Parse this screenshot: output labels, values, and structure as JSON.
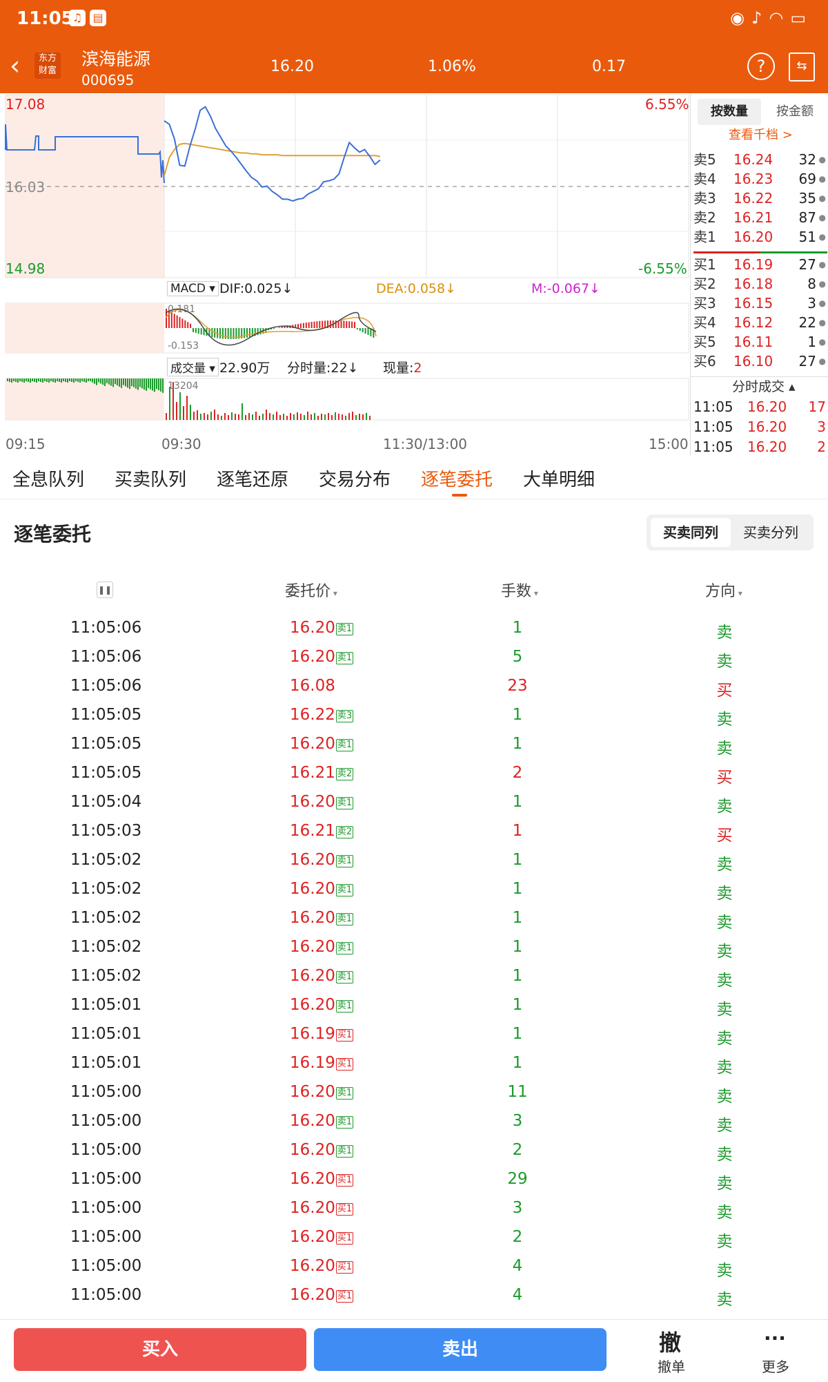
{
  "status_bar": {
    "time": "11:05"
  },
  "header": {
    "logo_text": "东方财富",
    "stock_name": "滨海能源",
    "stock_code": "000695",
    "price": "16.20",
    "change_pct": "1.06%",
    "change": "0.17"
  },
  "chart": {
    "price_high": "17.08",
    "price_low": "14.98",
    "price_mid": "16.03",
    "pct_high": "6.55%",
    "pct_low": "-6.55%",
    "macd_label": "MACD",
    "dif": "DIF:0.025",
    "dea": "DEA:0.058",
    "m": "M:-0.067",
    "macd_top": "0.181",
    "macd_bot": "-0.153",
    "vol_label": "成交量",
    "vol_total": "22.90万",
    "vol_min": "分时量:22",
    "vol_now_label": "现量:",
    "vol_now": "2",
    "vol_max": "13204",
    "time_start": "09:15",
    "time_open": "09:30",
    "time_mid": "11:30/13:00",
    "time_end": "15:00",
    "price_line": [
      16.78,
      16.74,
      16.57,
      16.27,
      16.26,
      16.49,
      16.68,
      16.9,
      16.94,
      16.83,
      16.69,
      16.59,
      16.49,
      16.43,
      16.36,
      16.28,
      16.2,
      16.13,
      16.09,
      16.02,
      16.03,
      15.97,
      15.93,
      15.88,
      15.88,
      15.86,
      15.88,
      15.89,
      15.94,
      15.97,
      16.0,
      16.08,
      16.09,
      16.11,
      16.17,
      16.36,
      16.53,
      16.47,
      16.42,
      16.45,
      16.37,
      16.28,
      16.33
    ],
    "avg_line": [
      16.15,
      16.36,
      16.45,
      16.51,
      16.52,
      16.51,
      16.5,
      16.49,
      16.48,
      16.47,
      16.46,
      16.45,
      16.44,
      16.43,
      16.42,
      16.41,
      16.41,
      16.4,
      16.4,
      16.39,
      16.39,
      16.39,
      16.39,
      16.38,
      16.38,
      16.38,
      16.38,
      16.38,
      16.38,
      16.38,
      16.38,
      16.38,
      16.38,
      16.38,
      16.38,
      16.38,
      16.38,
      16.38,
      16.38,
      16.38,
      16.38,
      16.38,
      16.37
    ]
  },
  "order_book": {
    "tab_qty": "按数量",
    "tab_amt": "按金额",
    "view_levels": "查看千档 >",
    "asks": [
      {
        "label": "卖5",
        "price": "16.24",
        "vol": "32"
      },
      {
        "label": "卖4",
        "price": "16.23",
        "vol": "69"
      },
      {
        "label": "卖3",
        "price": "16.22",
        "vol": "35"
      },
      {
        "label": "卖2",
        "price": "16.21",
        "vol": "87"
      },
      {
        "label": "卖1",
        "price": "16.20",
        "vol": "51"
      }
    ],
    "bids": [
      {
        "label": "买1",
        "price": "16.19",
        "vol": "27"
      },
      {
        "label": "买2",
        "price": "16.18",
        "vol": "8"
      },
      {
        "label": "买3",
        "price": "16.15",
        "vol": "3"
      },
      {
        "label": "买4",
        "price": "16.12",
        "vol": "22"
      },
      {
        "label": "买5",
        "price": "16.11",
        "vol": "1"
      },
      {
        "label": "买6",
        "price": "16.10",
        "vol": "27"
      }
    ],
    "trades_title": "分时成交",
    "trades": [
      {
        "time": "11:05",
        "price": "16.20",
        "vol": "17"
      },
      {
        "time": "11:05",
        "price": "16.20",
        "vol": "3"
      },
      {
        "time": "11:05",
        "price": "16.20",
        "vol": "2"
      }
    ]
  },
  "tabs": [
    "全息队列",
    "买卖队列",
    "逐笔还原",
    "交易分布",
    "逐笔委托",
    "大单明细"
  ],
  "section": {
    "title": "逐笔委托",
    "seg_same": "买卖同列",
    "seg_split": "买卖分列"
  },
  "table": {
    "col_price": "委托价",
    "col_qty": "手数",
    "col_dir": "方向",
    "rows": [
      {
        "time": "11:05:06",
        "price": "16.20",
        "badge": "卖1",
        "badge_color": "green",
        "qty": "1",
        "qty_color": "green",
        "dir": "卖",
        "dir_color": "green"
      },
      {
        "time": "11:05:06",
        "price": "16.20",
        "badge": "卖1",
        "badge_color": "green",
        "qty": "5",
        "qty_color": "green",
        "dir": "卖",
        "dir_color": "green"
      },
      {
        "time": "11:05:06",
        "price": "16.08",
        "badge": "",
        "badge_color": "",
        "qty": "23",
        "qty_color": "red",
        "dir": "买",
        "dir_color": "red"
      },
      {
        "time": "11:05:05",
        "price": "16.22",
        "badge": "卖3",
        "badge_color": "green",
        "qty": "1",
        "qty_color": "green",
        "dir": "卖",
        "dir_color": "green"
      },
      {
        "time": "11:05:05",
        "price": "16.20",
        "badge": "卖1",
        "badge_color": "green",
        "qty": "1",
        "qty_color": "green",
        "dir": "卖",
        "dir_color": "green"
      },
      {
        "time": "11:05:05",
        "price": "16.21",
        "badge": "卖2",
        "badge_color": "green",
        "qty": "2",
        "qty_color": "red",
        "dir": "买",
        "dir_color": "red"
      },
      {
        "time": "11:05:04",
        "price": "16.20",
        "badge": "卖1",
        "badge_color": "green",
        "qty": "1",
        "qty_color": "green",
        "dir": "卖",
        "dir_color": "green"
      },
      {
        "time": "11:05:03",
        "price": "16.21",
        "badge": "卖2",
        "badge_color": "green",
        "qty": "1",
        "qty_color": "red",
        "dir": "买",
        "dir_color": "red"
      },
      {
        "time": "11:05:02",
        "price": "16.20",
        "badge": "卖1",
        "badge_color": "green",
        "qty": "1",
        "qty_color": "green",
        "dir": "卖",
        "dir_color": "green"
      },
      {
        "time": "11:05:02",
        "price": "16.20",
        "badge": "卖1",
        "badge_color": "green",
        "qty": "1",
        "qty_color": "green",
        "dir": "卖",
        "dir_color": "green"
      },
      {
        "time": "11:05:02",
        "price": "16.20",
        "badge": "卖1",
        "badge_color": "green",
        "qty": "1",
        "qty_color": "green",
        "dir": "卖",
        "dir_color": "green"
      },
      {
        "time": "11:05:02",
        "price": "16.20",
        "badge": "卖1",
        "badge_color": "green",
        "qty": "1",
        "qty_color": "green",
        "dir": "卖",
        "dir_color": "green"
      },
      {
        "time": "11:05:02",
        "price": "16.20",
        "badge": "卖1",
        "badge_color": "green",
        "qty": "1",
        "qty_color": "green",
        "dir": "卖",
        "dir_color": "green"
      },
      {
        "time": "11:05:01",
        "price": "16.20",
        "badge": "卖1",
        "badge_color": "green",
        "qty": "1",
        "qty_color": "green",
        "dir": "卖",
        "dir_color": "green"
      },
      {
        "time": "11:05:01",
        "price": "16.19",
        "badge": "买1",
        "badge_color": "red",
        "qty": "1",
        "qty_color": "green",
        "dir": "卖",
        "dir_color": "green"
      },
      {
        "time": "11:05:01",
        "price": "16.19",
        "badge": "买1",
        "badge_color": "red",
        "qty": "1",
        "qty_color": "green",
        "dir": "卖",
        "dir_color": "green"
      },
      {
        "time": "11:05:00",
        "price": "16.20",
        "badge": "卖1",
        "badge_color": "green",
        "qty": "11",
        "qty_color": "green",
        "dir": "卖",
        "dir_color": "green"
      },
      {
        "time": "11:05:00",
        "price": "16.20",
        "badge": "卖1",
        "badge_color": "green",
        "qty": "3",
        "qty_color": "green",
        "dir": "卖",
        "dir_color": "green"
      },
      {
        "time": "11:05:00",
        "price": "16.20",
        "badge": "卖1",
        "badge_color": "green",
        "qty": "2",
        "qty_color": "green",
        "dir": "卖",
        "dir_color": "green"
      },
      {
        "time": "11:05:00",
        "price": "16.20",
        "badge": "买1",
        "badge_color": "red",
        "qty": "29",
        "qty_color": "green",
        "dir": "卖",
        "dir_color": "green"
      },
      {
        "time": "11:05:00",
        "price": "16.20",
        "badge": "买1",
        "badge_color": "red",
        "qty": "3",
        "qty_color": "green",
        "dir": "卖",
        "dir_color": "green"
      },
      {
        "time": "11:05:00",
        "price": "16.20",
        "badge": "买1",
        "badge_color": "red",
        "qty": "2",
        "qty_color": "green",
        "dir": "卖",
        "dir_color": "green"
      },
      {
        "time": "11:05:00",
        "price": "16.20",
        "badge": "买1",
        "badge_color": "red",
        "qty": "4",
        "qty_color": "green",
        "dir": "卖",
        "dir_color": "green"
      },
      {
        "time": "11:05:00",
        "price": "16.20",
        "badge": "买1",
        "badge_color": "red",
        "qty": "4",
        "qty_color": "green",
        "dir": "卖",
        "dir_color": "green"
      }
    ]
  },
  "bottom": {
    "buy": "买入",
    "sell": "卖出",
    "cancel_icon": "撤",
    "cancel": "撤单",
    "more_icon": "···",
    "more": "更多"
  },
  "colors": {
    "brand": "#EA5A0C",
    "up": "#DD2222",
    "down": "#1A9A2A",
    "buy_btn": "#EF5350",
    "sell_btn": "#3F8CF5"
  }
}
